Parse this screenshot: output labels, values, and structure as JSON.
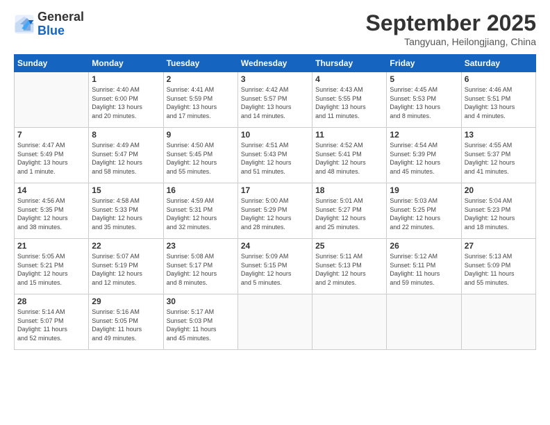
{
  "logo": {
    "general": "General",
    "blue": "Blue"
  },
  "header": {
    "month": "September 2025",
    "location": "Tangyuan, Heilongjiang, China"
  },
  "weekdays": [
    "Sunday",
    "Monday",
    "Tuesday",
    "Wednesday",
    "Thursday",
    "Friday",
    "Saturday"
  ],
  "weeks": [
    [
      {
        "num": "",
        "detail": ""
      },
      {
        "num": "1",
        "detail": "Sunrise: 4:40 AM\nSunset: 6:00 PM\nDaylight: 13 hours\nand 20 minutes."
      },
      {
        "num": "2",
        "detail": "Sunrise: 4:41 AM\nSunset: 5:59 PM\nDaylight: 13 hours\nand 17 minutes."
      },
      {
        "num": "3",
        "detail": "Sunrise: 4:42 AM\nSunset: 5:57 PM\nDaylight: 13 hours\nand 14 minutes."
      },
      {
        "num": "4",
        "detail": "Sunrise: 4:43 AM\nSunset: 5:55 PM\nDaylight: 13 hours\nand 11 minutes."
      },
      {
        "num": "5",
        "detail": "Sunrise: 4:45 AM\nSunset: 5:53 PM\nDaylight: 13 hours\nand 8 minutes."
      },
      {
        "num": "6",
        "detail": "Sunrise: 4:46 AM\nSunset: 5:51 PM\nDaylight: 13 hours\nand 4 minutes."
      }
    ],
    [
      {
        "num": "7",
        "detail": "Sunrise: 4:47 AM\nSunset: 5:49 PM\nDaylight: 13 hours\nand 1 minute."
      },
      {
        "num": "8",
        "detail": "Sunrise: 4:49 AM\nSunset: 5:47 PM\nDaylight: 12 hours\nand 58 minutes."
      },
      {
        "num": "9",
        "detail": "Sunrise: 4:50 AM\nSunset: 5:45 PM\nDaylight: 12 hours\nand 55 minutes."
      },
      {
        "num": "10",
        "detail": "Sunrise: 4:51 AM\nSunset: 5:43 PM\nDaylight: 12 hours\nand 51 minutes."
      },
      {
        "num": "11",
        "detail": "Sunrise: 4:52 AM\nSunset: 5:41 PM\nDaylight: 12 hours\nand 48 minutes."
      },
      {
        "num": "12",
        "detail": "Sunrise: 4:54 AM\nSunset: 5:39 PM\nDaylight: 12 hours\nand 45 minutes."
      },
      {
        "num": "13",
        "detail": "Sunrise: 4:55 AM\nSunset: 5:37 PM\nDaylight: 12 hours\nand 41 minutes."
      }
    ],
    [
      {
        "num": "14",
        "detail": "Sunrise: 4:56 AM\nSunset: 5:35 PM\nDaylight: 12 hours\nand 38 minutes."
      },
      {
        "num": "15",
        "detail": "Sunrise: 4:58 AM\nSunset: 5:33 PM\nDaylight: 12 hours\nand 35 minutes."
      },
      {
        "num": "16",
        "detail": "Sunrise: 4:59 AM\nSunset: 5:31 PM\nDaylight: 12 hours\nand 32 minutes."
      },
      {
        "num": "17",
        "detail": "Sunrise: 5:00 AM\nSunset: 5:29 PM\nDaylight: 12 hours\nand 28 minutes."
      },
      {
        "num": "18",
        "detail": "Sunrise: 5:01 AM\nSunset: 5:27 PM\nDaylight: 12 hours\nand 25 minutes."
      },
      {
        "num": "19",
        "detail": "Sunrise: 5:03 AM\nSunset: 5:25 PM\nDaylight: 12 hours\nand 22 minutes."
      },
      {
        "num": "20",
        "detail": "Sunrise: 5:04 AM\nSunset: 5:23 PM\nDaylight: 12 hours\nand 18 minutes."
      }
    ],
    [
      {
        "num": "21",
        "detail": "Sunrise: 5:05 AM\nSunset: 5:21 PM\nDaylight: 12 hours\nand 15 minutes."
      },
      {
        "num": "22",
        "detail": "Sunrise: 5:07 AM\nSunset: 5:19 PM\nDaylight: 12 hours\nand 12 minutes."
      },
      {
        "num": "23",
        "detail": "Sunrise: 5:08 AM\nSunset: 5:17 PM\nDaylight: 12 hours\nand 8 minutes."
      },
      {
        "num": "24",
        "detail": "Sunrise: 5:09 AM\nSunset: 5:15 PM\nDaylight: 12 hours\nand 5 minutes."
      },
      {
        "num": "25",
        "detail": "Sunrise: 5:11 AM\nSunset: 5:13 PM\nDaylight: 12 hours\nand 2 minutes."
      },
      {
        "num": "26",
        "detail": "Sunrise: 5:12 AM\nSunset: 5:11 PM\nDaylight: 11 hours\nand 59 minutes."
      },
      {
        "num": "27",
        "detail": "Sunrise: 5:13 AM\nSunset: 5:09 PM\nDaylight: 11 hours\nand 55 minutes."
      }
    ],
    [
      {
        "num": "28",
        "detail": "Sunrise: 5:14 AM\nSunset: 5:07 PM\nDaylight: 11 hours\nand 52 minutes."
      },
      {
        "num": "29",
        "detail": "Sunrise: 5:16 AM\nSunset: 5:05 PM\nDaylight: 11 hours\nand 49 minutes."
      },
      {
        "num": "30",
        "detail": "Sunrise: 5:17 AM\nSunset: 5:03 PM\nDaylight: 11 hours\nand 45 minutes."
      },
      {
        "num": "",
        "detail": ""
      },
      {
        "num": "",
        "detail": ""
      },
      {
        "num": "",
        "detail": ""
      },
      {
        "num": "",
        "detail": ""
      }
    ]
  ]
}
